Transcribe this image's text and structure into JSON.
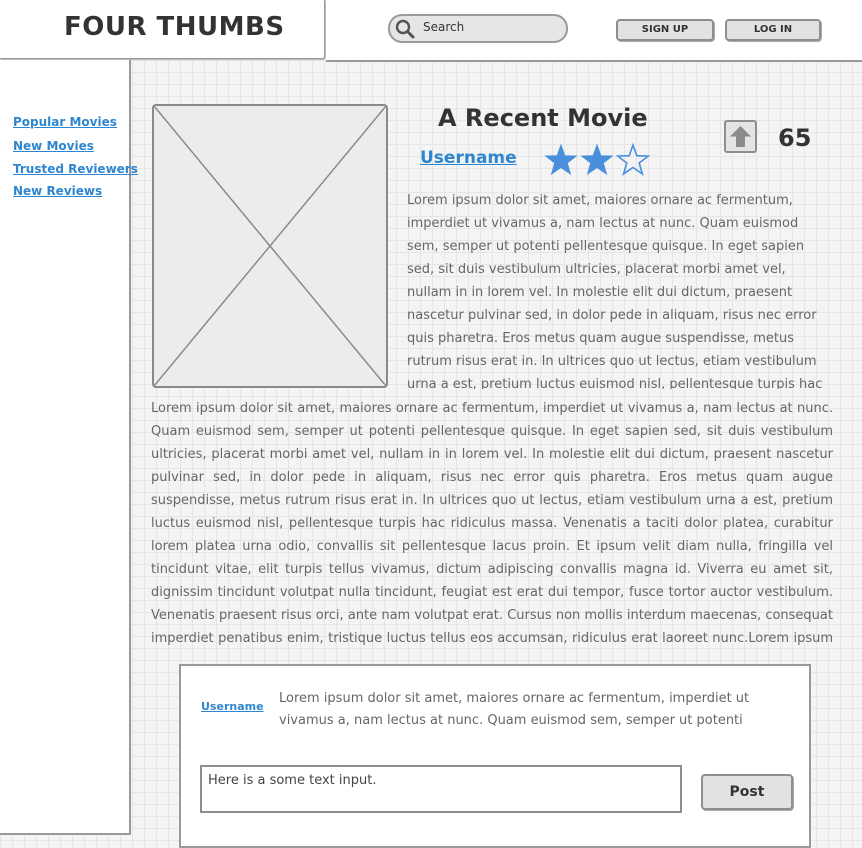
{
  "header": {
    "logo": "FOUR THUMBS",
    "search": {
      "placeholder": "Search",
      "icon": "search-icon"
    },
    "sign_up": "SIGN UP",
    "log_in": "LOG IN"
  },
  "sidebar": {
    "items": [
      {
        "label": "Popular Movies"
      },
      {
        "label": "New Movies"
      },
      {
        "label": "Trusted Reviewers"
      },
      {
        "label": "New Reviews"
      }
    ]
  },
  "movie": {
    "title": "A Recent Movie",
    "author": "Username",
    "rating": 2,
    "rating_max": 3,
    "votes": "65",
    "star_color": "#4a8fdc",
    "paragraph_1": "Lorem ipsum dolor sit amet, maiores ornare ac fermentum, imperdiet ut vivamus a, nam lectus at nunc. Quam euismod sem, semper ut potenti pellentesque quisque. In eget sapien sed, sit duis vestibulum ultricies, placerat morbi amet vel, nullam in in lorem vel. In molestie elit dui dictum, praesent nascetur pulvinar sed, in dolor pede in aliquam, risus nec error quis pharetra. Eros metus quam augue suspendisse, metus rutrum risus erat in.  In ultrices quo ut lectus, etiam vestibulum urna a est, pretium luctus euismod nisl, pellentesque turpis hac",
    "paragraph_2": "Lorem ipsum dolor sit amet, maiores ornare ac fermentum, imperdiet ut vivamus a, nam lectus at nunc. Quam euismod sem, semper ut potenti pellentesque quisque. In eget sapien sed, sit duis vestibulum ultricies, placerat morbi amet vel, nullam in in lorem vel. In molestie elit dui dictum, praesent nascetur pulvinar sed, in dolor pede in aliquam, risus nec error quis pharetra. Eros metus quam augue suspendisse, metus rutrum risus erat in.  In ultrices quo ut lectus, etiam vestibulum urna a est, pretium luctus euismod nisl, pellentesque turpis hac ridiculus massa. Venenatis a taciti dolor platea, curabitur lorem platea urna odio, convallis sit pellentesque lacus proin. Et ipsum velit diam nulla, fringilla vel tincidunt vitae, elit turpis tellus vivamus, dictum adipiscing convallis magna id. Viverra eu amet sit, dignissim tincidunt volutpat nulla tincidunt, feugiat est erat dui tempor, fusce tortor auctor vestibulum. Venenatis praesent risus orci, ante nam volutpat erat. Cursus non mollis interdum maecenas, consequat imperdiet penatibus enim, tristique luctus tellus eos accumsan, ridiculus erat laoreet nunc.Lorem ipsum dolor sit amet,"
  },
  "review": {
    "user": "Username",
    "text": "Lorem ipsum dolor sit amet, maiores ornare ac fermentum, imperdiet ut vivamus a, nam lectus at nunc. Quam euismod sem, semper ut potenti",
    "input_value": "Here is a some text input.",
    "post": "Post"
  }
}
